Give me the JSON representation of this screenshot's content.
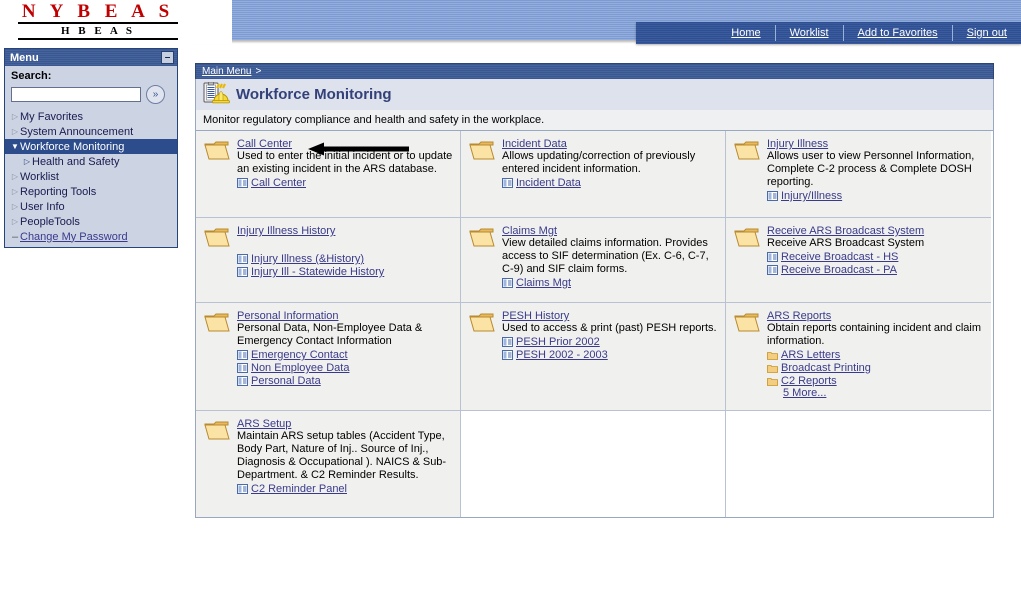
{
  "brand": {
    "line1": "N Y B E A S",
    "line2": "H B E A S"
  },
  "topnav": {
    "items": [
      {
        "label": "Home",
        "name": "nav-home"
      },
      {
        "label": "Worklist",
        "name": "nav-worklist"
      },
      {
        "label": "Add to Favorites",
        "name": "nav-add-to-favorites"
      },
      {
        "label": "Sign out",
        "name": "nav-sign-out"
      }
    ]
  },
  "menu": {
    "title": "Menu",
    "collapse_glyph": "–",
    "search_label": "Search:",
    "search_value": "",
    "search_placeholder": "",
    "search_go_glyph": "»",
    "items": [
      {
        "label": "My Favorites",
        "marker": "triangle",
        "state": "collapsed",
        "level": 0
      },
      {
        "label": "System Announcement",
        "marker": "triangle",
        "state": "collapsed",
        "level": 0
      },
      {
        "label": "Workforce Monitoring",
        "marker": "triangle-down",
        "state": "expanded",
        "level": 0,
        "selected": true
      },
      {
        "label": "Health and Safety",
        "marker": "triangle",
        "state": "collapsed",
        "level": 1
      },
      {
        "label": "Worklist",
        "marker": "triangle",
        "state": "collapsed",
        "level": 0
      },
      {
        "label": "Reporting Tools",
        "marker": "triangle",
        "state": "collapsed",
        "level": 0
      },
      {
        "label": "User Info",
        "marker": "triangle",
        "state": "collapsed",
        "level": 0
      },
      {
        "label": "PeopleTools",
        "marker": "triangle",
        "state": "collapsed",
        "level": 0
      },
      {
        "label": "Change My Password",
        "marker": "dash",
        "state": "link",
        "level": 0,
        "link": true
      }
    ]
  },
  "breadcrumb": {
    "root": "Main Menu",
    "separator": ">"
  },
  "page": {
    "title": "Workforce Monitoring",
    "subtitle": "Monitor regulatory compliance and health and safety in the workplace."
  },
  "tiles": [
    {
      "title": "Call Center",
      "desc": "Used to enter the initial incident or to update an existing incident in the ARS database.",
      "links": [
        {
          "label": "Call Center",
          "icon": "page-icon"
        }
      ]
    },
    {
      "title": "Incident Data",
      "desc": "Allows updating/correction of previously entered incident information.",
      "links": [
        {
          "label": "Incident Data",
          "icon": "page-icon"
        }
      ]
    },
    {
      "title": "Injury Illness",
      "desc": "Allows user to view Personnel Information, Complete C-2 process & Complete DOSH reporting.",
      "links": [
        {
          "label": "Injury/Illness",
          "icon": "page-icon"
        }
      ]
    },
    {
      "title": "Injury Illness History",
      "desc": "",
      "links": [
        {
          "label": "Injury Illness (&History)",
          "icon": "page-icon"
        },
        {
          "label": "Injury Ill - Statewide History",
          "icon": "page-icon"
        }
      ]
    },
    {
      "title": "Claims Mgt",
      "desc": "View detailed claims information. Provides access to SIF determination (Ex. C-6, C-7, C-9) and SIF claim forms.",
      "links": [
        {
          "label": "Claims Mgt",
          "icon": "page-icon"
        }
      ]
    },
    {
      "title": "Receive ARS Broadcast System",
      "desc": "Receive ARS Broadcast System",
      "links": [
        {
          "label": "Receive Broadcast - HS",
          "icon": "page-icon"
        },
        {
          "label": "Receive Broadcast - PA",
          "icon": "page-icon"
        }
      ]
    },
    {
      "title": "Personal Information",
      "desc": "Personal Data, Non-Employee Data & Emergency Contact Information",
      "links": [
        {
          "label": "Emergency Contact",
          "icon": "page-icon"
        },
        {
          "label": "Non Employee Data",
          "icon": "page-icon"
        },
        {
          "label": "Personal Data",
          "icon": "page-icon"
        }
      ]
    },
    {
      "title": "PESH History",
      "desc": "Used to access & print (past) PESH reports.",
      "links": [
        {
          "label": "PESH Prior 2002",
          "icon": "page-icon"
        },
        {
          "label": "PESH 2002 - 2003",
          "icon": "page-icon"
        }
      ]
    },
    {
      "title": "ARS Reports",
      "desc": "Obtain reports containing incident and claim information.",
      "links": [
        {
          "label": "ARS Letters",
          "icon": "folder-icon"
        },
        {
          "label": "Broadcast Printing",
          "icon": "folder-icon"
        },
        {
          "label": "C2 Reports",
          "icon": "folder-icon"
        }
      ],
      "more": "5 More..."
    },
    {
      "title": "ARS Setup",
      "desc": "Maintain ARS setup tables (Accident Type, Body Part, Nature of Inj.. Source of Inj., Diagnosis & Occupational ). NAICS & Sub-Department. & C2 Reminder Results.",
      "links": [
        {
          "label": "C2 Reminder Panel",
          "icon": "page-icon"
        }
      ]
    }
  ],
  "annotation": {
    "type": "arrow",
    "points_to": "Call Center",
    "color": "#000000"
  },
  "colors": {
    "accent_blue": "#3b5998",
    "link": "#3a3a8c",
    "brand_red": "#c00000",
    "tile_bg": "#f0f1ee",
    "menu_bg": "#ccd4e4",
    "selected": "#2c4c8c"
  }
}
